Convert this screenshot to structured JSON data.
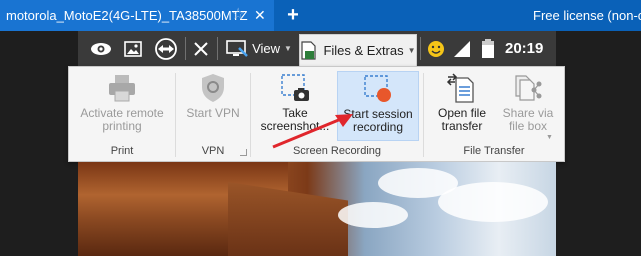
{
  "tab": {
    "title": "motorola_MotoE2(4G-LTE)_TA38500MTZ",
    "star": "☆",
    "close": "✕",
    "new_tab": "+"
  },
  "license_text": "Free license (non-co",
  "toolbar": {
    "view_label": "View",
    "files_label": "Files & Extras",
    "clock": "20:19",
    "battery_level": "81"
  },
  "ribbon": {
    "groups": [
      {
        "label": "Print",
        "buttons": [
          {
            "label": "Activate remote\nprinting",
            "disabled": true
          }
        ]
      },
      {
        "label": "VPN",
        "buttons": [
          {
            "label": "Start VPN",
            "disabled": true
          }
        ]
      },
      {
        "label": "Screen Recording",
        "buttons": [
          {
            "label": "Take\nscreenshot...",
            "disabled": false
          },
          {
            "label": "Start session\nrecording",
            "disabled": false,
            "highlighted": true
          }
        ]
      },
      {
        "label": "File Transfer",
        "buttons": [
          {
            "label": "Open file\ntransfer",
            "disabled": false
          },
          {
            "label": "Share via\nfile box",
            "disabled": true,
            "dropdown": true
          }
        ]
      }
    ]
  },
  "colors": {
    "tabbar": "#0a61b8",
    "tab_active": "#1974d2",
    "toolbar": "#3a3a3a",
    "ribbon_bg": "#f5f5f5",
    "highlight": "#d4e6fa",
    "record_dot": "#e8572b",
    "annotation_arrow": "#e0262c"
  }
}
